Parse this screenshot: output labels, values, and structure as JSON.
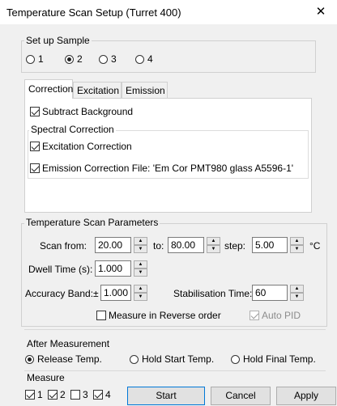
{
  "window": {
    "title": "Temperature Scan Setup (Turret 400)",
    "close_glyph": "✕"
  },
  "setup_sample": {
    "label": "Set up Sample",
    "options": [
      "1",
      "2",
      "3",
      "4"
    ],
    "selected": "2"
  },
  "tabs": [
    "Correction",
    "Excitation",
    "Emission"
  ],
  "active_tab": "Correction",
  "correction": {
    "subtract_background": {
      "label": "Subtract Background",
      "checked": true
    },
    "spectral_label": "Spectral Correction",
    "excitation_correction": {
      "label": "Excitation Correction",
      "checked": true
    },
    "emission_correction": {
      "label": "Emission Correction File: 'Em Cor PMT980 glass A5596-1'",
      "checked": true
    }
  },
  "scan_params": {
    "label": "Temperature Scan Parameters",
    "scan_from_label": "Scan from:",
    "scan_from": "20.00",
    "to_label": "to:",
    "to": "80.00",
    "step_label": "step:",
    "step": "5.00",
    "unit": "°C",
    "dwell_label": "Dwell Time (s):",
    "dwell": "1.000",
    "accuracy_label": "Accuracy Band:±",
    "accuracy": "1.000",
    "stabilisation_label": "Stabilisation Time:",
    "stabilisation": "60",
    "reverse": {
      "label": "Measure in Reverse order",
      "checked": false
    },
    "auto_pid": {
      "label": "Auto PID",
      "checked": true
    }
  },
  "after_measurement": {
    "label": "After Measurement",
    "options": [
      "Release Temp.",
      "Hold Start Temp.",
      "Hold Final Temp."
    ],
    "selected": "Release Temp."
  },
  "measure": {
    "label": "Measure",
    "items": [
      {
        "label": "1",
        "checked": true
      },
      {
        "label": "2",
        "checked": true
      },
      {
        "label": "3",
        "checked": false
      },
      {
        "label": "4",
        "checked": true
      }
    ]
  },
  "buttons": {
    "start": "Start",
    "cancel": "Cancel",
    "apply": "Apply"
  }
}
